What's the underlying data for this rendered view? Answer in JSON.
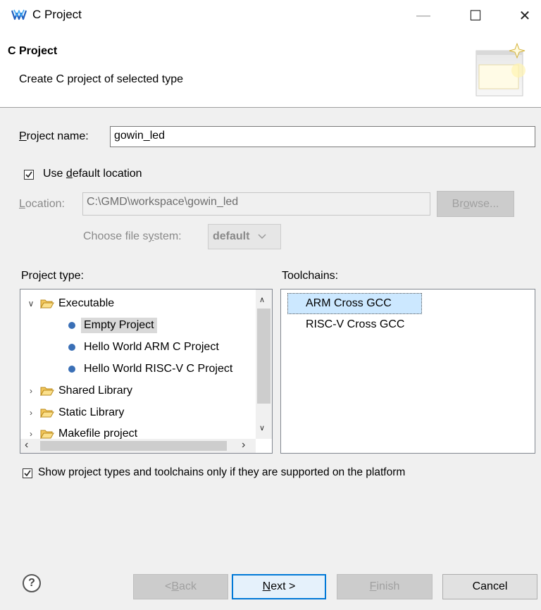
{
  "window": {
    "title": "C Project",
    "controls": {
      "minimize": "—",
      "maximize": "☐",
      "close": "✕"
    }
  },
  "header": {
    "title": "C Project",
    "description": "Create C project of selected type"
  },
  "form": {
    "project_name_label_u": "P",
    "project_name_label_rest": "roject name:",
    "project_name_value": "gowin_led",
    "use_default_pre": "Use ",
    "use_default_u": "d",
    "use_default_rest": "efault location",
    "use_default_checked": true,
    "location_label_u": "L",
    "location_label_rest": "ocation:",
    "location_value": "C:\\GMD\\workspace\\gowin_led",
    "browse_label_pre": "Br",
    "browse_label_u": "o",
    "browse_label_rest": "wse...",
    "filesystem_label_pre": "Choose file s",
    "filesystem_label_u": "y",
    "filesystem_label_rest": "stem:",
    "filesystem_value": "default"
  },
  "project_types": {
    "label": "Project type:",
    "items": [
      {
        "label": "Executable",
        "kind": "folder",
        "expanded": true
      },
      {
        "label": "Empty Project",
        "kind": "leaf",
        "selected": true
      },
      {
        "label": "Hello World ARM C Project",
        "kind": "leaf"
      },
      {
        "label": "Hello World RISC-V C Project",
        "kind": "leaf"
      },
      {
        "label": "Shared Library",
        "kind": "folder"
      },
      {
        "label": "Static Library",
        "kind": "folder"
      },
      {
        "label": "Makefile project",
        "kind": "folder"
      }
    ]
  },
  "toolchains": {
    "label": "Toolchains:",
    "items": [
      "ARM Cross GCC",
      "RISC-V Cross GCC"
    ],
    "selected_index": 0
  },
  "filter_checkbox": {
    "label": "Show project types and toolchains only if they are supported on the platform",
    "checked": true
  },
  "footer": {
    "help": "?",
    "back_pre": "< ",
    "back_u": "B",
    "back_rest": "ack",
    "next_u": "N",
    "next_rest": "ext >",
    "finish_u": "F",
    "finish_rest": "inish",
    "cancel": "Cancel"
  },
  "colors": {
    "accent": "#0078d7",
    "selection": "#cce8ff",
    "bullet": "#3a6fb6"
  }
}
